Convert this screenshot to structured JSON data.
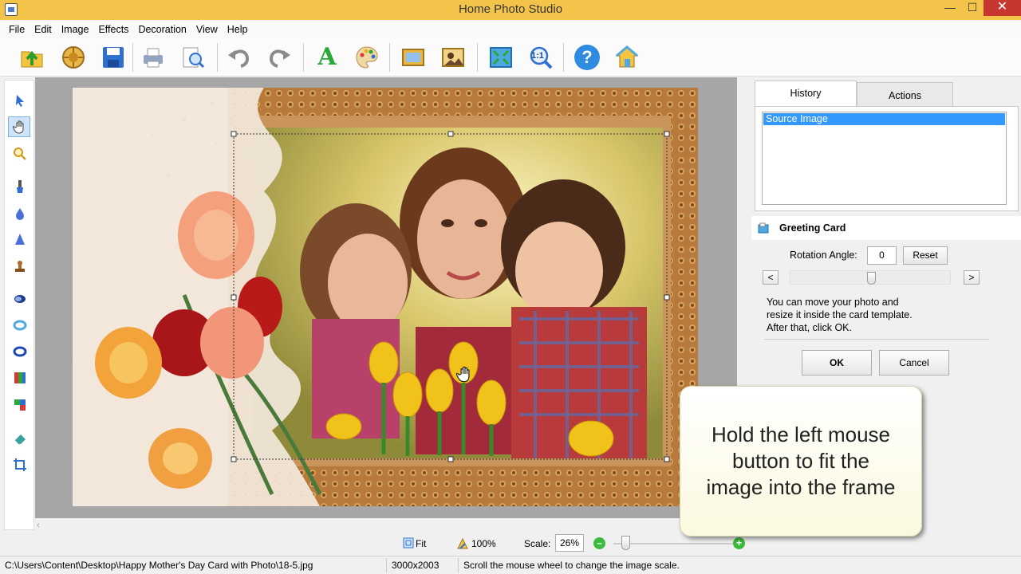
{
  "window": {
    "title": "Home Photo Studio",
    "minimize": "—",
    "maximize": "☐",
    "close": "✕"
  },
  "menu": [
    "File",
    "Edit",
    "Image",
    "Effects",
    "Decoration",
    "View",
    "Help"
  ],
  "toolbar": {
    "icons": [
      "open-icon",
      "camera-aperture-icon",
      "save-icon",
      "print-icon",
      "print-preview-icon",
      "undo-icon",
      "redo-icon",
      "text-icon",
      "palette-icon",
      "frame-icon",
      "photo-effects-icon",
      "fit-window-icon",
      "actual-size-icon",
      "help-icon",
      "home-icon"
    ],
    "text_tool_label": "A",
    "actual_size_label": "1:1",
    "help_label": "?"
  },
  "left_tools": [
    "pointer-icon",
    "hand-icon",
    "zoom-icon",
    "brush-icon",
    "drop-icon",
    "cone-icon",
    "stamp-icon",
    "eclipse-icon",
    "ring-icon",
    "ring-dark-icon",
    "color-balance-icon",
    "layers-icon",
    "eraser-icon",
    "crop-icon"
  ],
  "right_panel": {
    "tabs": {
      "history": "History",
      "actions": "Actions"
    },
    "history_items": [
      "Source Image"
    ],
    "greeting_card": {
      "title": "Greeting Card",
      "rotation_label": "Rotation Angle:",
      "rotation_value": "0",
      "reset_label": "Reset",
      "prev_label": "<",
      "next_label": ">",
      "slider_value": 0,
      "hint_lines": [
        "You can move your photo and",
        "resize it inside the card template.",
        "After that, click OK."
      ],
      "ok_label": "OK",
      "cancel_label": "Cancel"
    }
  },
  "callout": {
    "lines": [
      "Hold the left mouse",
      "button to fit the",
      "image into the frame"
    ]
  },
  "zoombar": {
    "fit_label": "Fit",
    "hundred_label": "100%",
    "scale_label": "Scale:",
    "scale_value": "26%",
    "minus": "–",
    "plus": "+"
  },
  "statusbar": {
    "path": "C:\\Users\\Content\\Desktop\\Happy Mother's Day Card with Photo\\18-5.jpg",
    "dimensions": "3000x2003",
    "hint": "Scroll the mouse wheel to change the image scale."
  },
  "colors": {
    "title_bar": "#f4c44a",
    "selection": "#3399ff",
    "close_button": "#c7372f",
    "zoom_buttons": "#3cba3c",
    "frame_gold": "#b77a3b"
  }
}
